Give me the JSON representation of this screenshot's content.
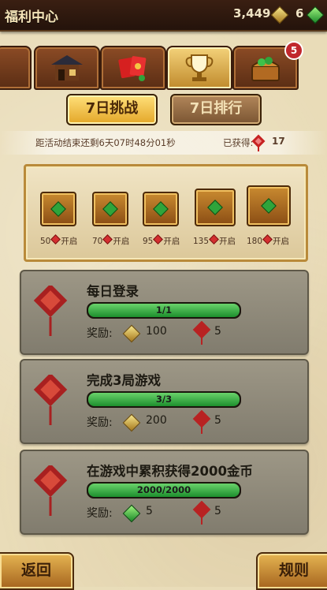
{
  "header": {
    "title": "福利中心",
    "gold": "3,449",
    "gems": "6"
  },
  "tabs": [
    {
      "name": "tab-shop",
      "icon": "shop-icon"
    },
    {
      "name": "tab-redpacket",
      "icon": "red-envelope-icon"
    },
    {
      "name": "tab-challenge",
      "icon": "trophy-icon",
      "active": true
    },
    {
      "name": "tab-treasure",
      "icon": "treasure-chest-icon",
      "badge": "5"
    }
  ],
  "segment": {
    "challenge": "7日挑战",
    "ranking": "7日排行"
  },
  "countdown": {
    "text": "距活动结束还剩6天07时48分01秒",
    "earned_label": "已获得:",
    "earned_value": "17"
  },
  "chests": [
    {
      "count": "50",
      "label": "开启"
    },
    {
      "count": "70",
      "label": "开启"
    },
    {
      "count": "95",
      "label": "开启"
    },
    {
      "count": "135",
      "label": "开启"
    },
    {
      "count": "180",
      "label": "开启"
    }
  ],
  "tasks": [
    {
      "name": "每日登录",
      "progress": "1/1",
      "progress_fraction": 1.0,
      "reward_label": "奖励:",
      "reward_amount": "100",
      "reward_icon": "gold-gem-icon",
      "knot_amount": "5"
    },
    {
      "name": "完成3局游戏",
      "progress": "3/3",
      "progress_fraction": 1.0,
      "reward_label": "奖励:",
      "reward_amount": "200",
      "reward_icon": "gold-gem-icon",
      "knot_amount": "5"
    },
    {
      "name": "在游戏中累积获得2000金币",
      "progress": "2000/2000",
      "progress_fraction": 1.0,
      "reward_label": "奖励:",
      "reward_amount": "5",
      "reward_icon": "green-gem-icon",
      "knot_amount": "5"
    }
  ],
  "footer": {
    "back": "返回",
    "rules": "规则"
  }
}
